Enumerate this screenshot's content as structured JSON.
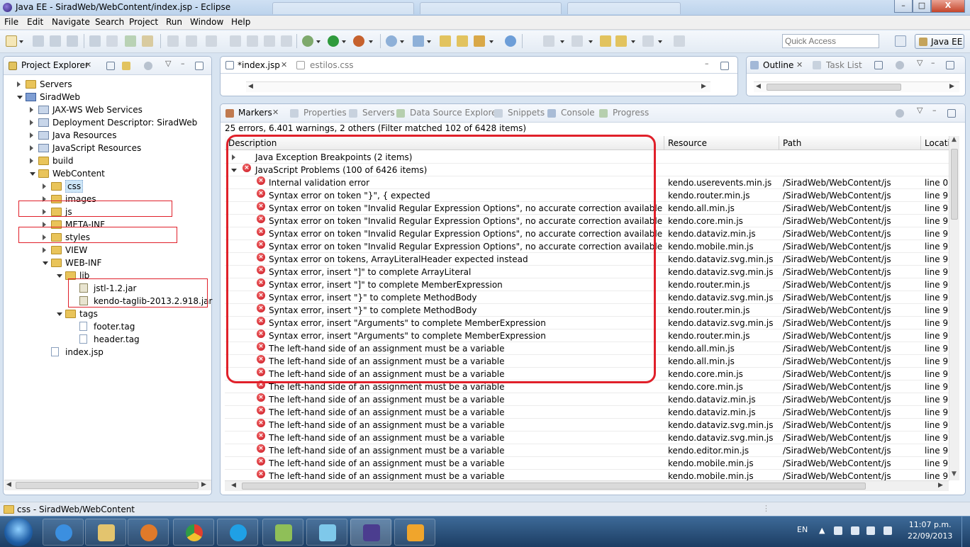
{
  "window": {
    "title": "Java EE - SiradWeb/WebContent/index.jsp - Eclipse",
    "min": "–",
    "max": "□",
    "close": "X"
  },
  "menu": [
    "File",
    "Edit",
    "Navigate",
    "Search",
    "Project",
    "Run",
    "Window",
    "Help"
  ],
  "toolbar": {
    "quick_access_placeholder": "Quick Access",
    "perspective": "Java EE"
  },
  "project_explorer": {
    "title": "Project Explorer",
    "tree": [
      {
        "label": "Servers",
        "depth": 0,
        "tw": "c",
        "icon": "fold"
      },
      {
        "label": "SiradWeb",
        "depth": 0,
        "tw": "e",
        "icon": "proj"
      },
      {
        "label": "JAX-WS Web Services",
        "depth": 1,
        "tw": "c",
        "icon": "cfg"
      },
      {
        "label": "Deployment Descriptor: SiradWeb",
        "depth": 1,
        "tw": "c",
        "icon": "cfg"
      },
      {
        "label": "Java Resources",
        "depth": 1,
        "tw": "c",
        "icon": "cfg"
      },
      {
        "label": "JavaScript Resources",
        "depth": 1,
        "tw": "c",
        "icon": "cfg"
      },
      {
        "label": "build",
        "depth": 1,
        "tw": "c",
        "icon": "fold"
      },
      {
        "label": "WebContent",
        "depth": 1,
        "tw": "e",
        "icon": "fold"
      },
      {
        "label": "css",
        "depth": 2,
        "tw": "c",
        "icon": "fold",
        "selected": true
      },
      {
        "label": "images",
        "depth": 2,
        "tw": "c",
        "icon": "fold"
      },
      {
        "label": "js",
        "depth": 2,
        "tw": "c",
        "icon": "fold"
      },
      {
        "label": "META-INF",
        "depth": 2,
        "tw": "c",
        "icon": "fold"
      },
      {
        "label": "styles",
        "depth": 2,
        "tw": "c",
        "icon": "fold"
      },
      {
        "label": "VIEW",
        "depth": 2,
        "tw": "c",
        "icon": "fold"
      },
      {
        "label": "WEB-INF",
        "depth": 2,
        "tw": "e",
        "icon": "fold"
      },
      {
        "label": "lib",
        "depth": 3,
        "tw": "e",
        "icon": "fold"
      },
      {
        "label": "jstl-1.2.jar",
        "depth": 4,
        "tw": "",
        "icon": "jar"
      },
      {
        "label": "kendo-taglib-2013.2.918.jar",
        "depth": 4,
        "tw": "",
        "icon": "jar"
      },
      {
        "label": "tags",
        "depth": 3,
        "tw": "e",
        "icon": "fold"
      },
      {
        "label": "footer.tag",
        "depth": 4,
        "tw": "",
        "icon": "file"
      },
      {
        "label": "header.tag",
        "depth": 4,
        "tw": "",
        "icon": "file"
      },
      {
        "label": "index.jsp",
        "depth": 2,
        "tw": "",
        "icon": "file"
      }
    ]
  },
  "editor": {
    "tabs": [
      {
        "label": "*index.jsp",
        "active": true
      },
      {
        "label": "estilos.css",
        "active": false
      }
    ]
  },
  "outline": {
    "tabs": [
      {
        "label": "Outline",
        "active": true
      },
      {
        "label": "Task List",
        "active": false
      }
    ]
  },
  "markers_view": {
    "tabs": [
      "Markers",
      "Properties",
      "Servers",
      "Data Source Explorer",
      "Snippets",
      "Console",
      "Progress"
    ],
    "summary": "25 errors, 6.401 warnings, 2 others (Filter matched 102 of 6428 items)",
    "columns": [
      "Description",
      "Resource",
      "Path",
      "Locati"
    ],
    "groups": [
      {
        "label": "Java Exception Breakpoints (2 items)",
        "expanded": false
      },
      {
        "label": "JavaScript Problems (100 of 6426 items)",
        "expanded": true
      }
    ],
    "rows": [
      {
        "description": "Internal validation error",
        "resource": "kendo.userevents.min.js",
        "path": "/SiradWeb/WebContent/js",
        "location": "line 0"
      },
      {
        "description": "Syntax error on token \"}\", { expected",
        "resource": "kendo.router.min.js",
        "path": "/SiradWeb/WebContent/js",
        "location": "line 9"
      },
      {
        "description": "Syntax error on token \"Invalid Regular Expression Options\", no accurate correction available",
        "resource": "kendo.all.min.js",
        "path": "/SiradWeb/WebContent/js",
        "location": "line 9"
      },
      {
        "description": "Syntax error on token \"Invalid Regular Expression Options\", no accurate correction available",
        "resource": "kendo.core.min.js",
        "path": "/SiradWeb/WebContent/js",
        "location": "line 9"
      },
      {
        "description": "Syntax error on token \"Invalid Regular Expression Options\", no accurate correction available",
        "resource": "kendo.dataviz.min.js",
        "path": "/SiradWeb/WebContent/js",
        "location": "line 9"
      },
      {
        "description": "Syntax error on token \"Invalid Regular Expression Options\", no accurate correction available",
        "resource": "kendo.mobile.min.js",
        "path": "/SiradWeb/WebContent/js",
        "location": "line 9"
      },
      {
        "description": "Syntax error on tokens, ArrayLiteralHeader expected instead",
        "resource": "kendo.dataviz.svg.min.js",
        "path": "/SiradWeb/WebContent/js",
        "location": "line 9"
      },
      {
        "description": "Syntax error, insert \"]\" to complete ArrayLiteral",
        "resource": "kendo.dataviz.svg.min.js",
        "path": "/SiradWeb/WebContent/js",
        "location": "line 9"
      },
      {
        "description": "Syntax error, insert \"]\" to complete MemberExpression",
        "resource": "kendo.router.min.js",
        "path": "/SiradWeb/WebContent/js",
        "location": "line 9"
      },
      {
        "description": "Syntax error, insert \"}\" to complete MethodBody",
        "resource": "kendo.dataviz.svg.min.js",
        "path": "/SiradWeb/WebContent/js",
        "location": "line 9"
      },
      {
        "description": "Syntax error, insert \"}\" to complete MethodBody",
        "resource": "kendo.router.min.js",
        "path": "/SiradWeb/WebContent/js",
        "location": "line 9"
      },
      {
        "description": "Syntax error, insert \"Arguments\" to complete MemberExpression",
        "resource": "kendo.dataviz.svg.min.js",
        "path": "/SiradWeb/WebContent/js",
        "location": "line 9"
      },
      {
        "description": "Syntax error, insert \"Arguments\" to complete MemberExpression",
        "resource": "kendo.router.min.js",
        "path": "/SiradWeb/WebContent/js",
        "location": "line 9"
      },
      {
        "description": "The left-hand side of an assignment must be a variable",
        "resource": "kendo.all.min.js",
        "path": "/SiradWeb/WebContent/js",
        "location": "line 9"
      },
      {
        "description": "The left-hand side of an assignment must be a variable",
        "resource": "kendo.all.min.js",
        "path": "/SiradWeb/WebContent/js",
        "location": "line 9"
      },
      {
        "description": "The left-hand side of an assignment must be a variable",
        "resource": "kendo.core.min.js",
        "path": "/SiradWeb/WebContent/js",
        "location": "line 9"
      },
      {
        "description": "The left-hand side of an assignment must be a variable",
        "resource": "kendo.core.min.js",
        "path": "/SiradWeb/WebContent/js",
        "location": "line 9"
      },
      {
        "description": "The left-hand side of an assignment must be a variable",
        "resource": "kendo.dataviz.min.js",
        "path": "/SiradWeb/WebContent/js",
        "location": "line 9"
      },
      {
        "description": "The left-hand side of an assignment must be a variable",
        "resource": "kendo.dataviz.min.js",
        "path": "/SiradWeb/WebContent/js",
        "location": "line 9"
      },
      {
        "description": "The left-hand side of an assignment must be a variable",
        "resource": "kendo.dataviz.svg.min.js",
        "path": "/SiradWeb/WebContent/js",
        "location": "line 9"
      },
      {
        "description": "The left-hand side of an assignment must be a variable",
        "resource": "kendo.dataviz.svg.min.js",
        "path": "/SiradWeb/WebContent/js",
        "location": "line 9"
      },
      {
        "description": "The left-hand side of an assignment must be a variable",
        "resource": "kendo.editor.min.js",
        "path": "/SiradWeb/WebContent/js",
        "location": "line 9"
      },
      {
        "description": "The left-hand side of an assignment must be a variable",
        "resource": "kendo.mobile.min.js",
        "path": "/SiradWeb/WebContent/js",
        "location": "line 9"
      },
      {
        "description": "The left-hand side of an assignment must be a variable",
        "resource": "kendo.mobile.min.js",
        "path": "/SiradWeb/WebContent/js",
        "location": "line 9"
      }
    ]
  },
  "statusbar": {
    "text": "css - SiradWeb/WebContent"
  },
  "taskbar": {
    "lang": "EN",
    "time": "11:07 p.m.",
    "date": "22/09/2013"
  },
  "colors": {
    "highlight": "#e0202a",
    "error": "#c8101c",
    "selection": "#cde6f7"
  }
}
